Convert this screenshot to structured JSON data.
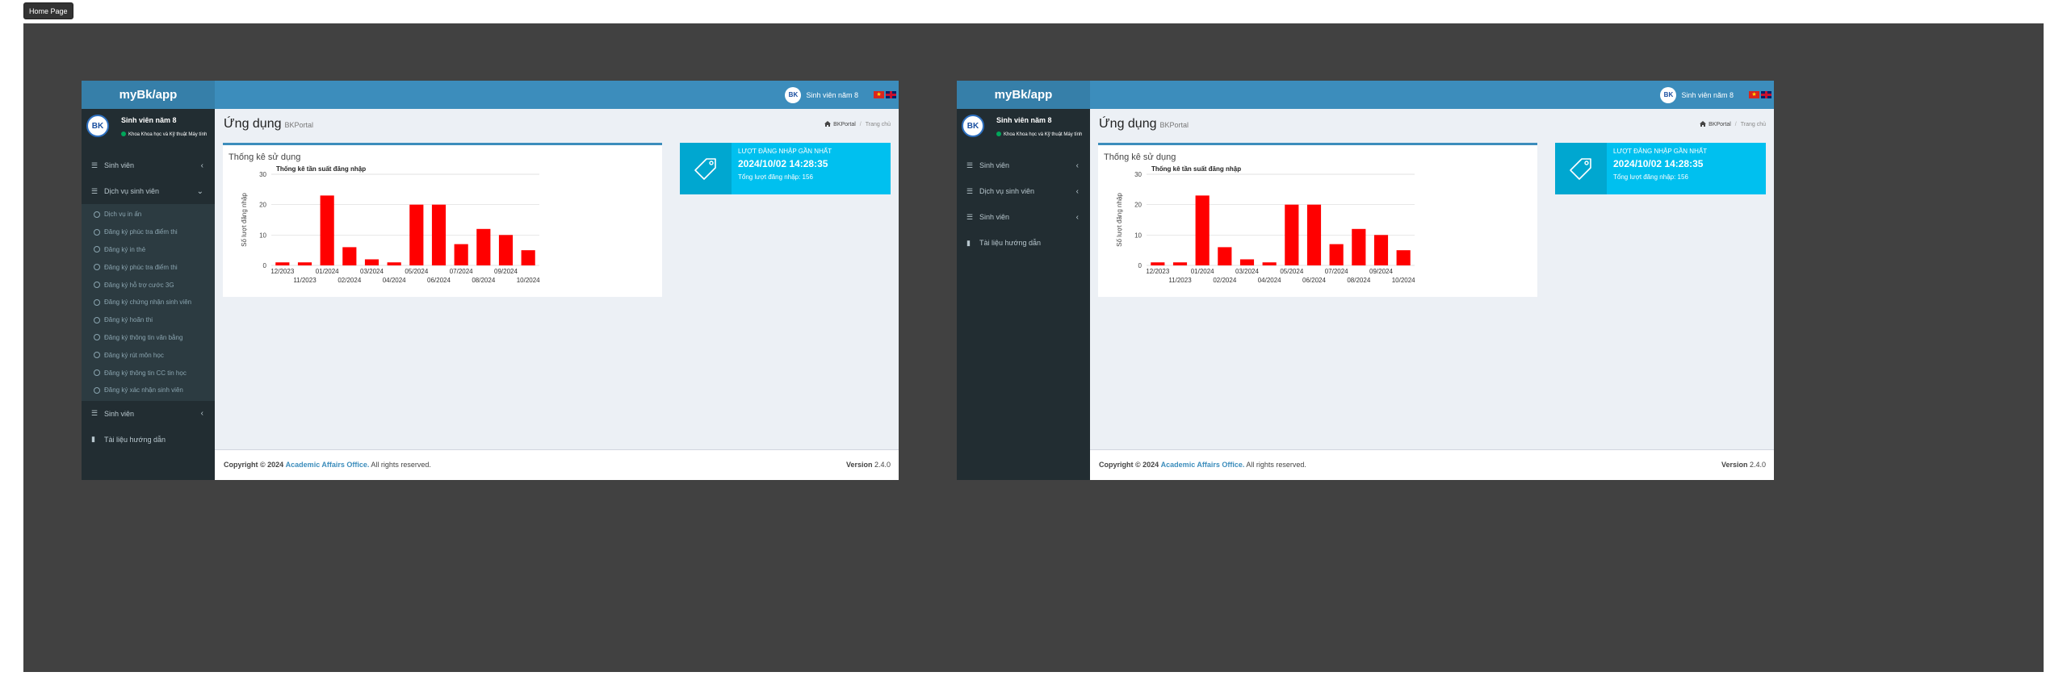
{
  "home_button": "Home Page",
  "app": {
    "logo": "myBk/app",
    "top_user": "Sinh viên năm 8",
    "avatar_text": "BK",
    "flag_vn": "★",
    "user_name": "Sinh viên năm 8",
    "user_dept": "Khoa Khoa học và Kỹ thuật Máy tính"
  },
  "menu": {
    "sinh_vien": "Sinh viên",
    "dich_vu": "Dịch vụ sinh viên",
    "tai_lieu": "Tài liệu hướng dẫn",
    "chev_left": "‹",
    "chev_down": "⌄",
    "sub_items": [
      "Dịch vụ in ấn",
      "Đăng ký phúc tra điểm thi",
      "Đăng ký in thẻ",
      "Đăng ký phúc tra điểm thi",
      "Đăng ký hỗ trợ cước 3G",
      "Đăng ký chứng nhận sinh viên",
      "Đăng ký hoãn thi",
      "Đăng ký thông tin văn bằng",
      "Đăng ký rút môn học",
      "Đăng ký thông tin CC tin học",
      "Đăng ký xác nhận sinh viên"
    ]
  },
  "content": {
    "title": "Ứng dụng",
    "subtitle": "BKPortal",
    "crumb_home": "BKPortal",
    "crumb_active": "Trang chủ",
    "box_title": "Thống kê sử dụng"
  },
  "info": {
    "label": "Lượt đăng nhập gần nhất",
    "value": "2024/10/02 14:28:35",
    "sub": "Tổng lượt đăng nhập: 156"
  },
  "footer": {
    "copy_prefix": "Copyright © 2024",
    "org": "Academic Affairs Office.",
    "copy_suffix": "All rights reserved.",
    "version_label": "Version",
    "version": "2.4.0"
  },
  "colors": {
    "header": "#3c8dbc",
    "sidebar": "#222d32",
    "info_box": "#00c0ef",
    "bar": "#ff0000"
  },
  "chart_data": {
    "type": "bar",
    "title": "Thống kê tần suất đăng nhập",
    "ylabel": "Số lượt đăng nhập",
    "xlabel": "",
    "categories": [
      "12/2023",
      "11/2023",
      "01/2024",
      "02/2024",
      "03/2024",
      "04/2024",
      "05/2024",
      "06/2024",
      "07/2024",
      "08/2024",
      "09/2024",
      "10/2024"
    ],
    "values": [
      1,
      1,
      23,
      6,
      2,
      1,
      20,
      20,
      7,
      12,
      10,
      5
    ],
    "ylim": [
      0,
      30
    ],
    "yticks": [
      0,
      10,
      20,
      30
    ],
    "grid": true
  }
}
